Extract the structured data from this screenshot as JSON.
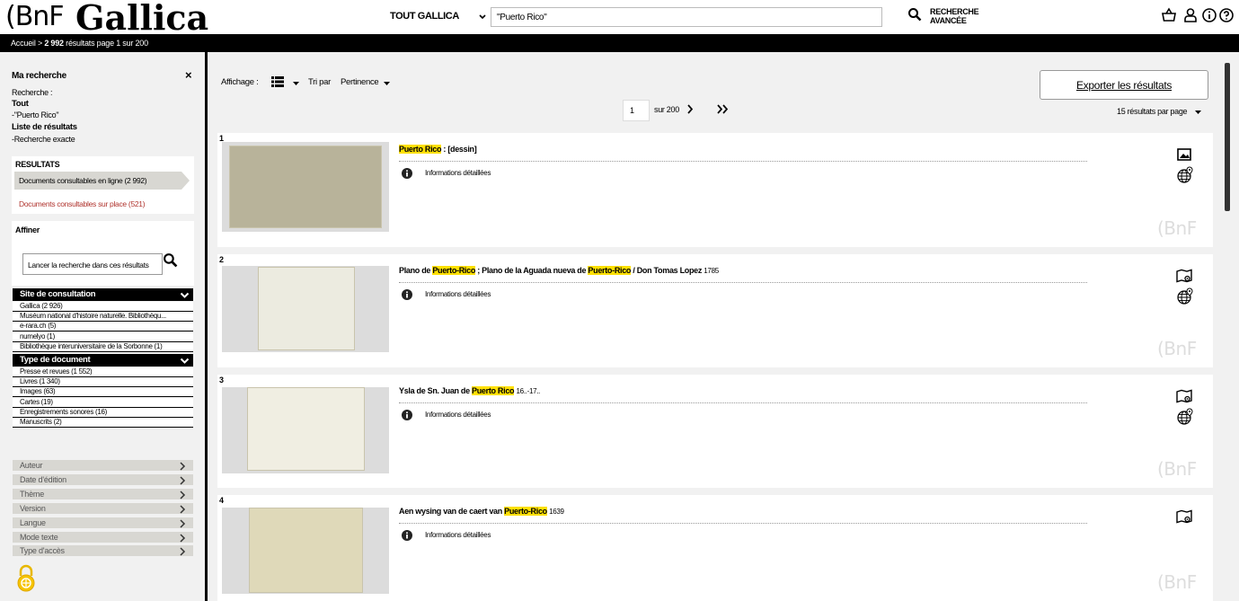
{
  "header": {
    "logo_bnf": "(BnF",
    "logo_gallica": "Gallica",
    "scope": "TOUT GALLICA",
    "search_value": "\"Puerto Rico\"",
    "advanced_line1": "RECHERCHE",
    "advanced_line2": "AVANCÉE"
  },
  "breadcrumb": {
    "home": "Accueil",
    "sep": ">",
    "count": "2 992",
    "rest": "résultats page 1 sur 200"
  },
  "sidebar": {
    "my_search_title": "Ma recherche",
    "close": "×",
    "lines": [
      {
        "text": "Recherche :",
        "bold": false
      },
      {
        "text": "Tout",
        "bold": true
      },
      {
        "text": "-\"Puerto Rico\"",
        "bold": false
      },
      {
        "text": "Liste de résultats",
        "bold": true
      },
      {
        "text": "-Recherche exacte",
        "bold": false
      }
    ],
    "results_title": "RESULTATS",
    "online": "Documents consultables en ligne (2 992)",
    "onsite": "Documents consultables sur place (521)",
    "refine_title": "Affiner",
    "refine_placeholder": "Lancer la recherche dans ces résultats",
    "facets_open": [
      {
        "title": "Site de consultation",
        "items": [
          "Gallica (2 926)",
          "Muséum national d'histoire naturelle. Bibliothèqu...",
          "e-rara.ch (5)",
          "numelyo (1)",
          "Bibliothèque interuniversitaire de la Sorbonne (1)"
        ]
      },
      {
        "title": "Type de document",
        "items": [
          "Presse et revues (1 552)",
          "Livres (1 340)",
          "Images (63)",
          "Cartes (19)",
          "Enregistrements sonores (16)",
          "Manuscrits (2)"
        ]
      }
    ],
    "facets_closed": [
      "Auteur",
      "Date d'édition",
      "Thème",
      "Version",
      "Langue",
      "Mode texte",
      "Type d'accès"
    ]
  },
  "toolbar": {
    "display_label": "Affichage :",
    "sort_label": "Tri par",
    "sort_value": "Pertinence",
    "page_value": "1",
    "page_total": "sur 200",
    "export_label": "Exporter les résultats",
    "per_page": "15 résultats par page"
  },
  "results": [
    {
      "num": "1",
      "parts": [
        {
          "t": "Puerto Rico",
          "hl": true
        },
        {
          "t": " : [dessin]",
          "hl": false
        }
      ],
      "date": "",
      "info": "Informations détaillées",
      "type_icon": "image-icon",
      "watermark": "(BnF"
    },
    {
      "num": "2",
      "parts": [
        {
          "t": "Plano de ",
          "hl": false
        },
        {
          "t": "Puerto-Rico",
          "hl": true
        },
        {
          "t": " ; Plano de la Aguada nueva de ",
          "hl": false
        },
        {
          "t": "Puerto-Rico",
          "hl": true
        },
        {
          "t": " / Don Tomas Lopez",
          "hl": false
        }
      ],
      "date": "1785",
      "info": "Informations détaillées",
      "type_icon": "map-icon",
      "watermark": "(BnF"
    },
    {
      "num": "3",
      "parts": [
        {
          "t": "Ysla de Sn. Juan de ",
          "hl": false
        },
        {
          "t": "Puerto Rico",
          "hl": true
        }
      ],
      "date": "16..-17..",
      "info": "Informations détaillées",
      "type_icon": "map-icon",
      "watermark": "(BnF"
    },
    {
      "num": "4",
      "parts": [
        {
          "t": "Aen wysing van de caert van ",
          "hl": false
        },
        {
          "t": "Puerto-Rico",
          "hl": true
        }
      ],
      "date": "1639",
      "info": "Informations détaillées",
      "type_icon": "map-icon",
      "watermark": "(BnF"
    }
  ]
}
